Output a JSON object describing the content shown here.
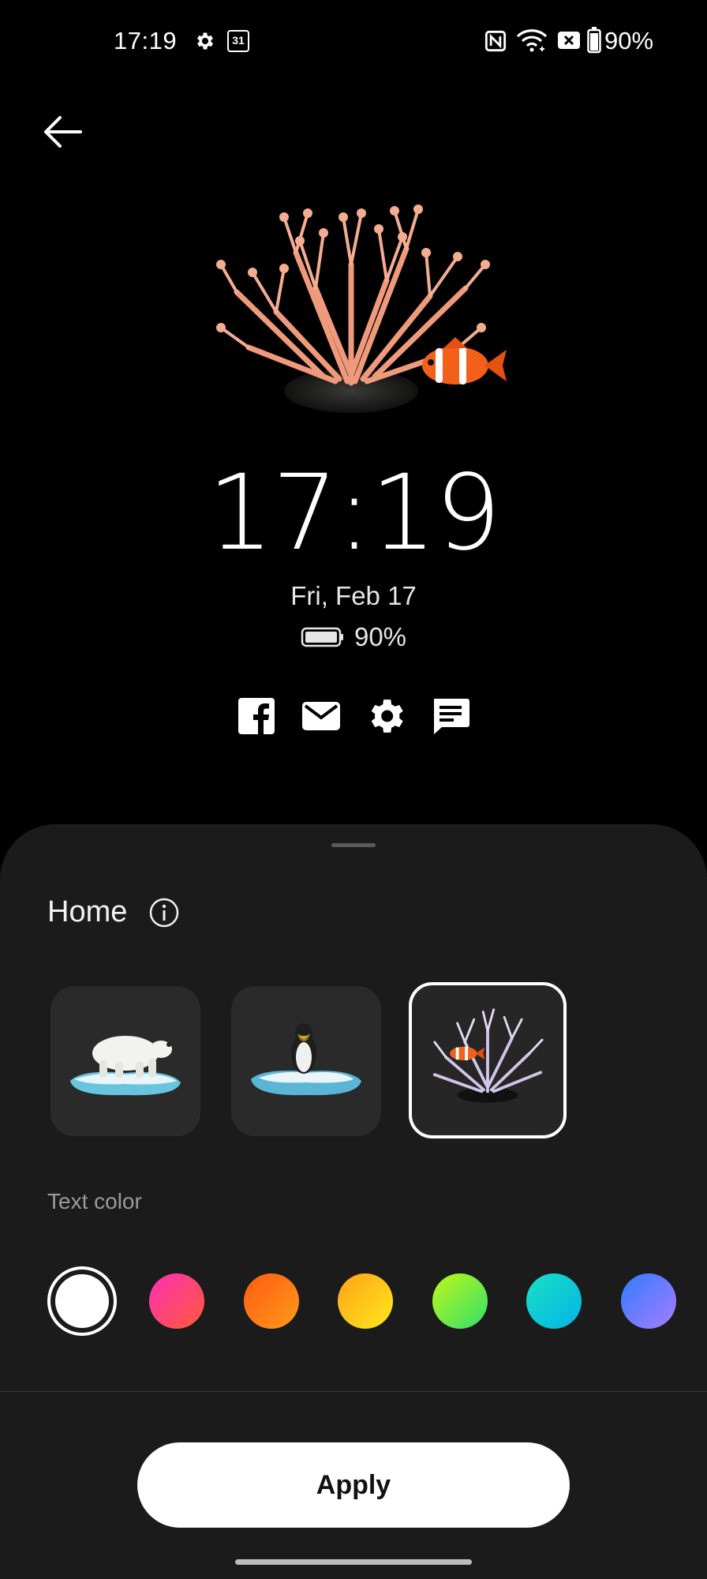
{
  "status_bar": {
    "time": "17:19",
    "icons": [
      "settings-icon",
      "calendar-icon"
    ],
    "calendar_day": "31",
    "right_icons": [
      "nfc-icon",
      "wifi-icon",
      "no-sim-icon",
      "battery-icon"
    ],
    "battery": "90%"
  },
  "preview": {
    "clock": "17:19",
    "date": "Fri, Feb 17",
    "battery": "90%",
    "notification_icons": [
      "facebook-icon",
      "mail-icon",
      "settings-icon",
      "message-icon"
    ]
  },
  "sheet": {
    "title": "Home",
    "styles": [
      {
        "name": "polar-bear",
        "selected": false
      },
      {
        "name": "penguin",
        "selected": false
      },
      {
        "name": "coral",
        "selected": true
      }
    ],
    "text_color_label": "Text color",
    "colors": [
      {
        "name": "white",
        "selected": true,
        "color": "#ffffff"
      },
      {
        "name": "pink",
        "color_from": "#ff2fb4",
        "color_to": "#ff5a3a"
      },
      {
        "name": "orange",
        "color_from": "#ff5a12",
        "color_to": "#ff9a1a"
      },
      {
        "name": "yellow",
        "color_from": "#ffa21a",
        "color_to": "#ffe81a"
      },
      {
        "name": "green",
        "color_from": "#c3f71a",
        "color_to": "#2ee06a"
      },
      {
        "name": "teal",
        "color_from": "#18e1c5",
        "color_to": "#05b3e6"
      },
      {
        "name": "blue",
        "color_from": "#2f7cff",
        "color_to": "#a87cff"
      }
    ],
    "apply_label": "Apply"
  }
}
